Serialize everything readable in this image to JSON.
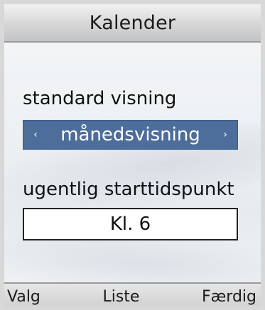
{
  "title": "Kalender",
  "settings": {
    "default_view": {
      "label": "standard visning",
      "value": "månedsvisning",
      "left_arrow": "‹",
      "right_arrow": "›"
    },
    "week_start": {
      "label": "ugentlig starttidspunkt",
      "value": "Kl. 6"
    }
  },
  "softkeys": {
    "left": "Valg",
    "center": "Liste",
    "right": "Færdig"
  },
  "colors": {
    "selection": "#4d6d9a",
    "title_bar": "#d6d6d6"
  }
}
